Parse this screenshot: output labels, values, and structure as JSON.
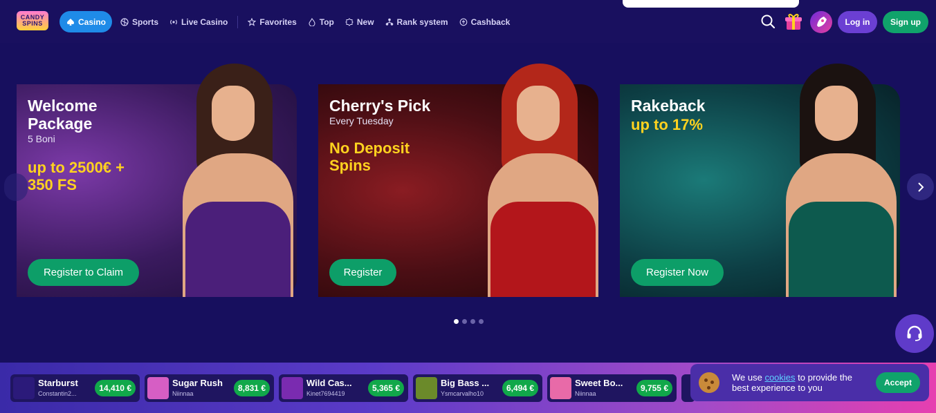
{
  "logo": {
    "line1": "CANDY",
    "line2": "SPINS"
  },
  "nav": {
    "items": [
      {
        "label": "Casino",
        "icon": "spade-icon"
      },
      {
        "label": "Sports",
        "icon": "ball-icon"
      },
      {
        "label": "Live Casino",
        "icon": "live-icon"
      },
      {
        "label": "Favorites",
        "icon": "star-icon"
      },
      {
        "label": "Top",
        "icon": "flame-icon"
      },
      {
        "label": "New",
        "icon": "badge-icon"
      },
      {
        "label": "Rank system",
        "icon": "rank-icon"
      },
      {
        "label": "Cashback",
        "icon": "cashback-icon"
      }
    ],
    "login": "Log in",
    "signup": "Sign up"
  },
  "banners": [
    {
      "title1": "Welcome",
      "title2": "Package",
      "sub": "5 Boni",
      "hl1": "up to 2500€ +",
      "hl2": "350 FS",
      "button": "Register to Claim"
    },
    {
      "title1": "Cherry's Pick",
      "sub": "Every Tuesday",
      "hl1": "No Deposit",
      "hl2": "Spins",
      "button": "Register"
    },
    {
      "title1": "Rakeback",
      "hl1": "up to 17%",
      "button": "Register Now"
    }
  ],
  "winners": [
    {
      "game": "Starburst",
      "user": "Constantin2...",
      "amount": "14,410 €",
      "color": "#2b1a7a"
    },
    {
      "game": "Sugar Rush",
      "user": "Niinnaa",
      "amount": "8,831 €",
      "color": "#d65ec4"
    },
    {
      "game": "Wild Cas...",
      "user": "Kinet7694419",
      "amount": "5,365 €",
      "color": "#7a2bb0"
    },
    {
      "game": "Big Bass ...",
      "user": "Ysmcarvalho10",
      "amount": "6,494 €",
      "color": "#6b8a2a"
    },
    {
      "game": "Sweet Bo...",
      "user": "Niinnaa",
      "amount": "9,755 €",
      "color": "#e86aa8"
    }
  ],
  "cookie": {
    "pre": "We use ",
    "link": "cookies",
    "post": " to provide the best experience to you",
    "accept": "Accept"
  }
}
